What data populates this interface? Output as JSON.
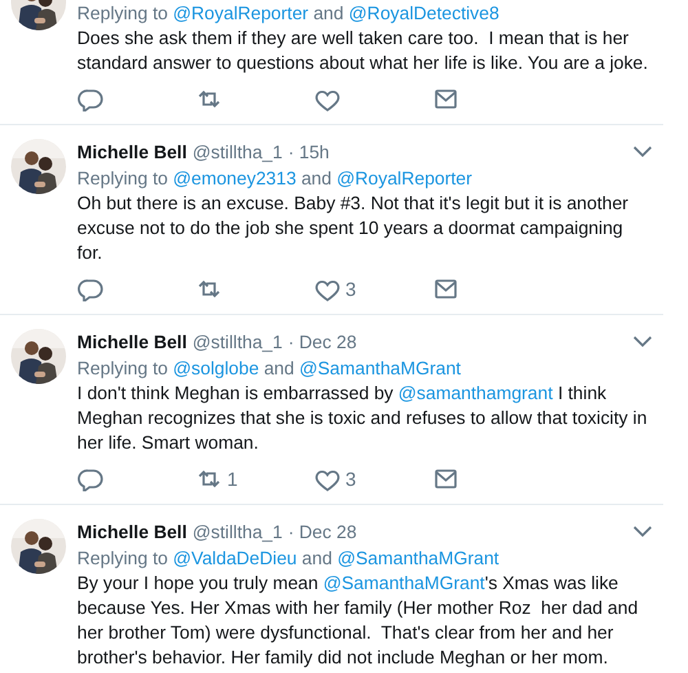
{
  "tweets": [
    {
      "partial": true,
      "replying_to": [
        {
          "kind": "text",
          "text": "Replying to "
        },
        {
          "kind": "mention",
          "text": "@RoyalReporter"
        },
        {
          "kind": "text",
          "text": " and "
        },
        {
          "kind": "mention",
          "text": "@RoyalDetective8"
        }
      ],
      "body": [
        {
          "kind": "text",
          "text": "Does she ask them if they are well taken care too.  I mean that is her standard answer to questions about what her life is like. You are a joke."
        }
      ],
      "actions": [
        {
          "kind": "reply"
        },
        {
          "kind": "retweet"
        },
        {
          "kind": "like"
        },
        {
          "kind": "message"
        }
      ]
    },
    {
      "partial": false,
      "author": "Michelle Bell",
      "handle": "@stilltha_1",
      "time": "· 15h",
      "replying_to": [
        {
          "kind": "text",
          "text": "Replying to "
        },
        {
          "kind": "mention",
          "text": "@emoney2313"
        },
        {
          "kind": "text",
          "text": " and "
        },
        {
          "kind": "mention",
          "text": "@RoyalReporter"
        }
      ],
      "body": [
        {
          "kind": "text",
          "text": "Oh but there is an excuse. Baby #3. Not that it's legit but it is another excuse not to do the job she spent 10 years a doormat campaigning for."
        }
      ],
      "actions": [
        {
          "kind": "reply"
        },
        {
          "kind": "retweet"
        },
        {
          "kind": "like",
          "count": "3"
        },
        {
          "kind": "message"
        }
      ]
    },
    {
      "partial": false,
      "author": "Michelle Bell",
      "handle": "@stilltha_1",
      "time": "· Dec 28",
      "replying_to": [
        {
          "kind": "text",
          "text": "Replying to "
        },
        {
          "kind": "mention",
          "text": "@solglobe"
        },
        {
          "kind": "text",
          "text": " and "
        },
        {
          "kind": "mention",
          "text": "@SamanthaMGrant"
        }
      ],
      "body": [
        {
          "kind": "text",
          "text": "I don't think Meghan is embarrassed by "
        },
        {
          "kind": "mention",
          "text": "@samanthamgrant"
        },
        {
          "kind": "text",
          "text": " I think Meghan recognizes that she is toxic and refuses to allow that toxicity in her life. Smart woman."
        }
      ],
      "actions": [
        {
          "kind": "reply"
        },
        {
          "kind": "retweet",
          "count": "1"
        },
        {
          "kind": "like",
          "count": "3"
        },
        {
          "kind": "message"
        }
      ]
    },
    {
      "partial": false,
      "author": "Michelle Bell",
      "handle": "@stilltha_1",
      "time": "· Dec 28",
      "replying_to": [
        {
          "kind": "text",
          "text": "Replying to "
        },
        {
          "kind": "mention",
          "text": "@ValdaDeDieu"
        },
        {
          "kind": "text",
          "text": " and "
        },
        {
          "kind": "mention",
          "text": "@SamanthaMGrant"
        }
      ],
      "body": [
        {
          "kind": "text",
          "text": "By your I hope you truly mean "
        },
        {
          "kind": "mention",
          "text": "@SamanthaMGrant"
        },
        {
          "kind": "text",
          "text": "'s Xmas was like because Yes. Her Xmas with her family (Her mother Roz  her dad and her brother Tom) were dysfunctional.  That's clear from her and her brother's behavior. Her family did not include Meghan or her mom."
        }
      ]
    }
  ]
}
